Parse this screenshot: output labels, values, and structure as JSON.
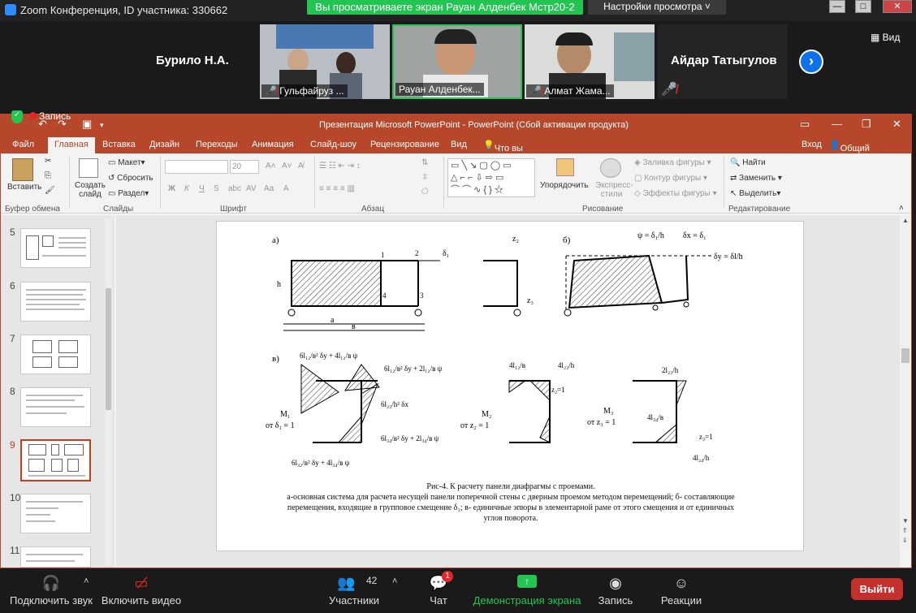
{
  "zoom": {
    "window_title": "Zoom Конференция, ID участника: 330662",
    "share_banner": "Вы просматриваете экран Рауан Алденбек Мстр20-2",
    "view_options": "Настройки просмотра",
    "view_label": "Вид",
    "participants_gallery": [
      {
        "name": "Бурило Н.А.",
        "kind": "name-only"
      },
      {
        "name": "Гульфайруз ...",
        "kind": "video",
        "muted": true
      },
      {
        "name": "Рауан Алденбек...",
        "kind": "video",
        "muted": false,
        "active": true
      },
      {
        "name": "Алмат Жама...",
        "kind": "video",
        "muted": true
      },
      {
        "name": "Айдар Татыгулов",
        "kind": "name-only"
      }
    ],
    "recording_label": "Запись"
  },
  "ppt": {
    "title": "Презентация Microsoft PowerPoint - PowerPoint (Сбой активации продукта)",
    "tabs": [
      "Файл",
      "Главная",
      "Вставка",
      "Дизайн",
      "Переходы",
      "Анимация",
      "Слайд-шоу",
      "Рецензирование",
      "Вид"
    ],
    "active_tab": "Главная",
    "tell_me": "Что вы хотите сделать?",
    "sign_in": "Вход",
    "share": "Общий доступ",
    "ribbon": {
      "paste": "Вставить",
      "new_slide": "Создать слайд",
      "layout": "Макет",
      "reset": "Сбросить",
      "section": "Раздел",
      "font_size": "20",
      "arrange": "Упорядочить",
      "quick_styles": "Экспресс-стили",
      "shape_fill": "Заливка фигуры",
      "shape_outline": "Контур фигуры",
      "shape_effects": "Эффекты фигуры",
      "find": "Найти",
      "replace": "Заменить",
      "select": "Выделить",
      "groups": {
        "clipboard": "Буфер обмена",
        "slides": "Слайды",
        "font": "Шрифт",
        "paragraph": "Абзац",
        "drawing": "Рисование",
        "editing": "Редактирование"
      }
    },
    "slide_numbers": [
      "5",
      "6",
      "7",
      "8",
      "9",
      "10",
      "11"
    ],
    "selected_slide": "9",
    "caption": {
      "line1": "Рис-4. К расчету панели диафрагмы с проемами.",
      "line2": "а-основная система для расчета несущей панели поперечной стены с дверным проемом методом перемещений; б- составляющие",
      "line3": "перемещения, входящие в групповое смещение δ₁; в- единичные эпюры в элементарной раме от этого смещения и от единичных",
      "line4": "углов поворота."
    },
    "figure_labels": {
      "a": "а)",
      "b": "б)",
      "v": "в)",
      "h": "h",
      "a_dim": "a",
      "v_dim": "в",
      "n1": "1",
      "n2": "2",
      "n3": "3",
      "n4": "4",
      "delta1": "δ₁",
      "z2": "z₂",
      "z3": "z₃",
      "psi": "ψ = δ₁/h",
      "dx": "δx = δ₁",
      "dy": "δy = δl/h",
      "m1": "M₁",
      "m1b": "от δ₁ = 1",
      "m2": "M₂",
      "m2b": "от z₂ = 1",
      "m3": "M₃",
      "m3b": "от z₃ = 1",
      "z2eq": "z₂=1",
      "z3eq": "z₃=1",
      "top_formula": "6l₁₂/в² δy + 4l₁₂/в ψ",
      "right_formula1": "6l₁₂/в² δy + 2l₁₂/в ψ",
      "mid_formula": "6l₂₃/h² δx",
      "low_formula": "6l₃₄/в² δy + 2l₃₄/в ψ",
      "bottom_formula": "6l₃₂/в² δy + 4l₃₄/в ψ",
      "m2_top1": "4l₁₂/в",
      "m2_top2": "4l₂₃/h",
      "m3_top": "2l₂₃/h",
      "m3_mid": "4l₃₄/в",
      "m3_bot": "4l₂₄/h"
    }
  },
  "toolbar": {
    "audio": "Подключить звук",
    "video": "Включить видео",
    "participants_label": "Участники",
    "participants_count": "42",
    "chat": "Чат",
    "chat_badge": "1",
    "share": "Демонстрация экрана",
    "record": "Запись",
    "reactions": "Реакции",
    "leave": "Выйти"
  },
  "colors": {
    "ppt_accent": "#b7472a",
    "zoom_green": "#23c552",
    "zoom_blue": "#0e72ed",
    "leave_red": "#c4302b"
  }
}
